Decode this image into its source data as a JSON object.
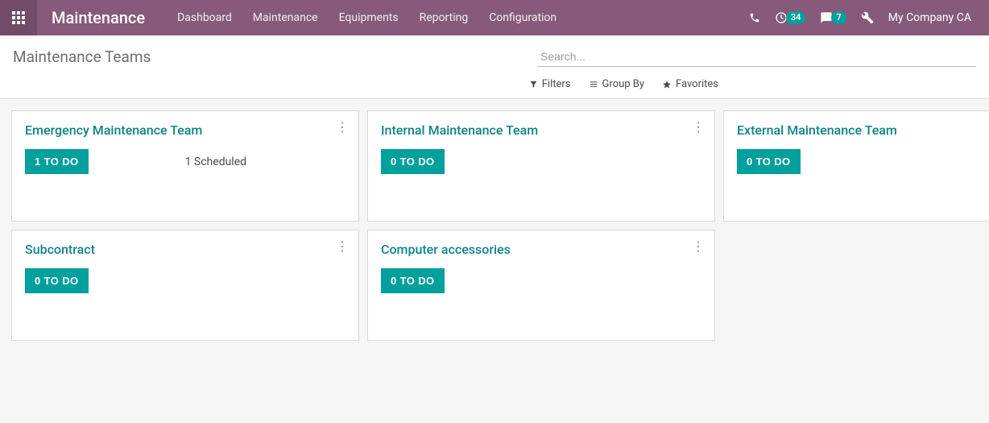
{
  "header": {
    "brand": "Maintenance",
    "menu": [
      "Dashboard",
      "Maintenance",
      "Equipments",
      "Reporting",
      "Configuration"
    ],
    "activity_badge": "34",
    "discuss_badge": "7",
    "company": "My Company CA"
  },
  "control_panel": {
    "breadcrumb": "Maintenance Teams",
    "search_placeholder": "Search...",
    "filters_label": "Filters",
    "group_by_label": "Group By",
    "favorites_label": "Favorites"
  },
  "cards": [
    {
      "title": "Emergency Maintenance Team",
      "todo_label": "1 TO DO",
      "extra": "1 Scheduled"
    },
    {
      "title": "Internal Maintenance Team",
      "todo_label": "0 TO DO",
      "extra": ""
    },
    {
      "title": "External Maintenance Team",
      "todo_label": "0 TO DO",
      "extra": ""
    },
    {
      "title": "Subcontract",
      "todo_label": "0 TO DO",
      "extra": ""
    },
    {
      "title": "Computer accessories",
      "todo_label": "0 TO DO",
      "extra": ""
    }
  ]
}
